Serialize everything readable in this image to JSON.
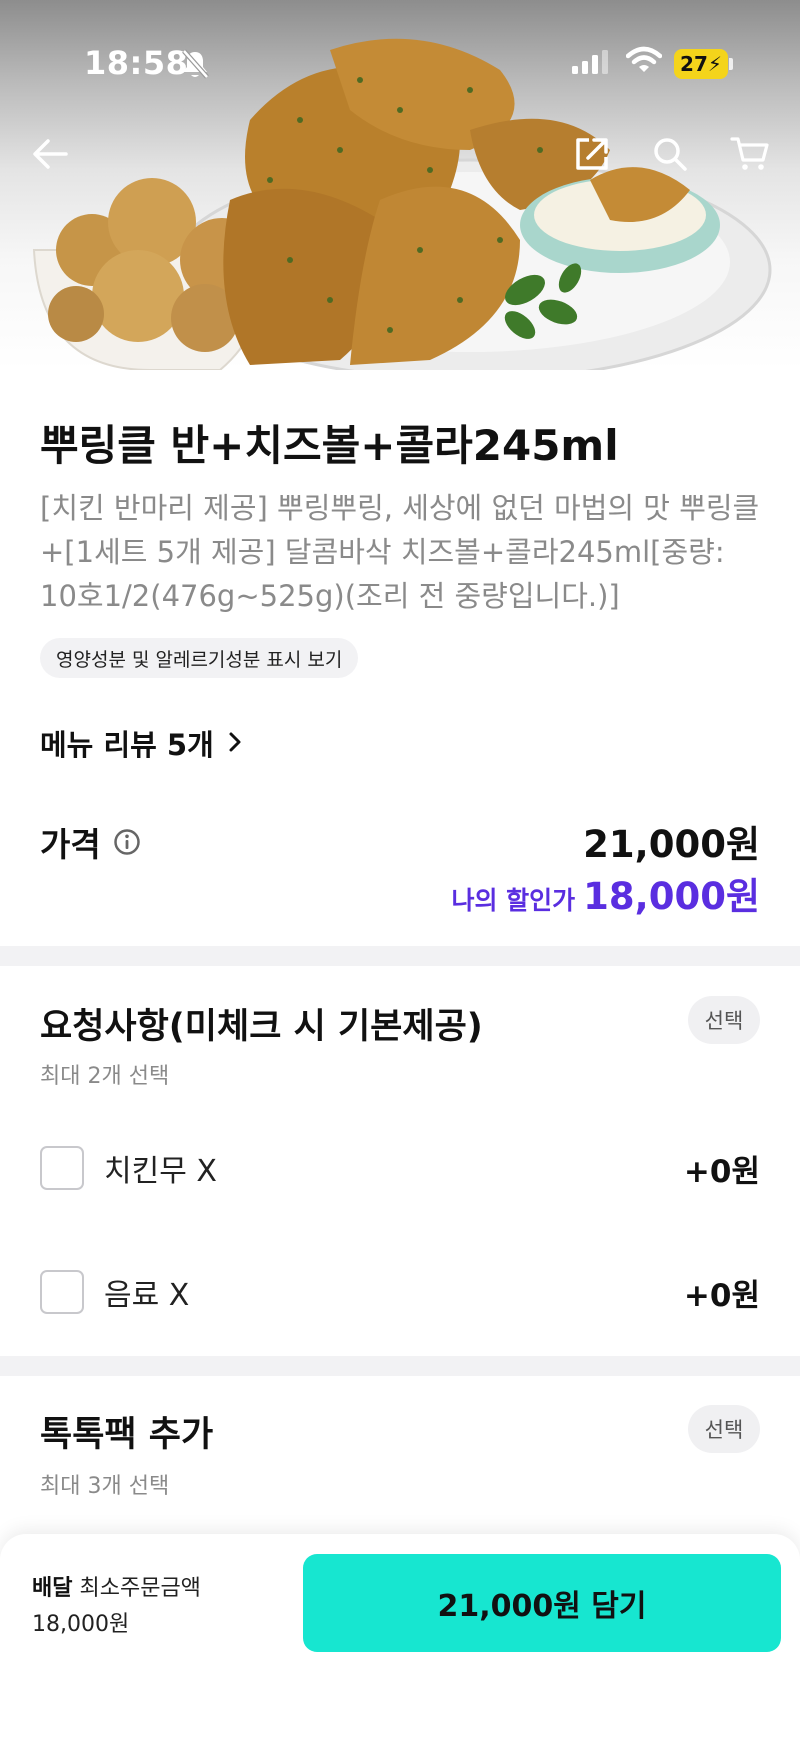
{
  "status_bar": {
    "time": "18:58",
    "battery": "27",
    "icons": [
      "bell-muted-icon",
      "cellular-signal-icon",
      "wifi-icon",
      "battery-charging-icon"
    ]
  },
  "toolbar": {
    "icons": [
      "back-arrow-icon",
      "share-icon",
      "search-icon",
      "cart-icon"
    ]
  },
  "product": {
    "title": "뿌링클 반+치즈볼+콜라245ml",
    "description": "[치킨 반마리 제공] 뿌링뿌링, 세상에 없던 마법의 맛 뿌링클+[1세트 5개 제공] 달콤바삭 치즈볼+콜라245ml[중량: 10호1/2(476g~525g)(조리 전 중량입니다.)]",
    "nutrition_chip": "영양성분 및 알레르기성분 표시 보기",
    "review_link": "메뉴 리뷰 5개"
  },
  "price": {
    "label": "가격",
    "value": "21,000원",
    "discount_label": "나의 할인가",
    "discount_value": "18,000원"
  },
  "sections": [
    {
      "title": "요청사항(미체크 시 기본제공)",
      "subtitle": "최대 2개 선택",
      "badge": "선택",
      "options": [
        {
          "label": "치킨무 X",
          "price": "+0원",
          "checked": false
        },
        {
          "label": "음료 X",
          "price": "+0원",
          "checked": false
        }
      ]
    },
    {
      "title": "톡톡팩 추가",
      "subtitle": "최대 3개 선택",
      "badge": "선택"
    }
  ],
  "bottom_bar": {
    "delivery_label": "배달",
    "min_order_label": "최소주문금액",
    "min_order_value": "18,000원",
    "add_button": "21,000원 담기"
  },
  "colors": {
    "discount": "#5a2ee0",
    "add_button": "#17e6d0",
    "battery": "#f4d41b",
    "divider": "#f2f2f4"
  }
}
